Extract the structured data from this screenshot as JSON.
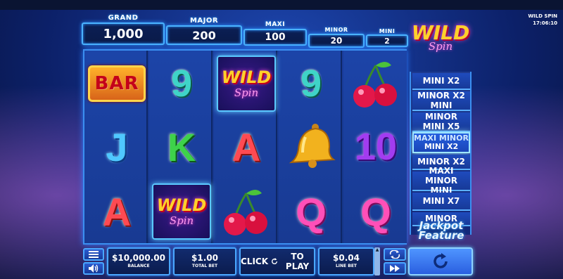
{
  "game": {
    "name": "WILD SPIN",
    "time": "17:06:10"
  },
  "jackpots": {
    "grand": {
      "label": "GRAND",
      "value": "1,000"
    },
    "major": {
      "label": "MAJOR",
      "value": "200"
    },
    "maxi": {
      "label": "MAXI",
      "value": "100"
    },
    "minor": {
      "label": "MINOR",
      "value": "20"
    },
    "mini": {
      "label": "MINI",
      "value": "2"
    }
  },
  "logo": {
    "word1": "WILD",
    "word2": "Spin"
  },
  "reels": [
    [
      "BAR",
      "J",
      "A"
    ],
    [
      "9",
      "K",
      "WILD"
    ],
    [
      "WILD",
      "A",
      "cherry"
    ],
    [
      "9",
      "bell",
      "Q"
    ],
    [
      "cherry",
      "10",
      "Q"
    ]
  ],
  "wild_symbol": {
    "word1": "WILD",
    "word2": "Spin"
  },
  "jackpot_feature": {
    "title_line1": "Jackpot",
    "title_line2": "Feature",
    "items": [
      {
        "line1": "MINI X2",
        "line2": ""
      },
      {
        "line1": "MINOR X2",
        "line2": "MINI"
      },
      {
        "line1": "MINOR",
        "line2": "MINI X5"
      },
      {
        "line1": "MAXI MINOR",
        "line2": "MINI X2"
      },
      {
        "line1": "MINOR X2",
        "line2": ""
      },
      {
        "line1": "MAXI  MINOR",
        "line2": "MINI"
      },
      {
        "line1": "MINI X7",
        "line2": ""
      },
      {
        "line1": "MINOR",
        "line2": ""
      }
    ]
  },
  "controls": {
    "balance": {
      "value": "$10,000.00",
      "caption": "BALANCE"
    },
    "total_bet": {
      "value": "$1.00",
      "caption": "TOTAL BET"
    },
    "play": {
      "before": "CLICK",
      "after": "TO PLAY"
    },
    "line_bet": {
      "value": "$0.04",
      "caption": "LINE BET"
    }
  },
  "icons": {
    "menu": "menu-icon",
    "sound": "speaker-icon",
    "autoplay": "repeat-icon",
    "turbo": "fast-forward-icon",
    "spin": "spin-icon"
  }
}
